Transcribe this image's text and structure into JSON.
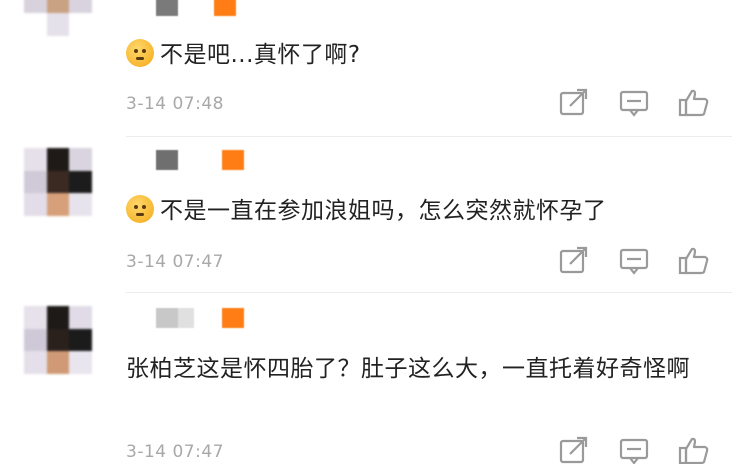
{
  "comments": [
    {
      "text": "不是吧...真怀了啊?",
      "time": "3-14 07:48",
      "emoji": "shushing-face-emoji"
    },
    {
      "text": "不是一直在参加浪姐吗，怎么突然就怀孕了",
      "time": "3-14 07:47",
      "emoji": "surprised-face-emoji"
    },
    {
      "text": "张柏芝这是怀四胎了？肚子这么大，一直托着好奇怪啊",
      "time": "3-14 07:47"
    }
  ],
  "icons": {
    "share": "share-icon",
    "comment": "comment-icon",
    "like": "thumbs-up-icon"
  },
  "colors": {
    "badge": "#ff7d14",
    "time": "#a8a8a8",
    "text": "#222222",
    "icon": "#9a9a9a"
  }
}
